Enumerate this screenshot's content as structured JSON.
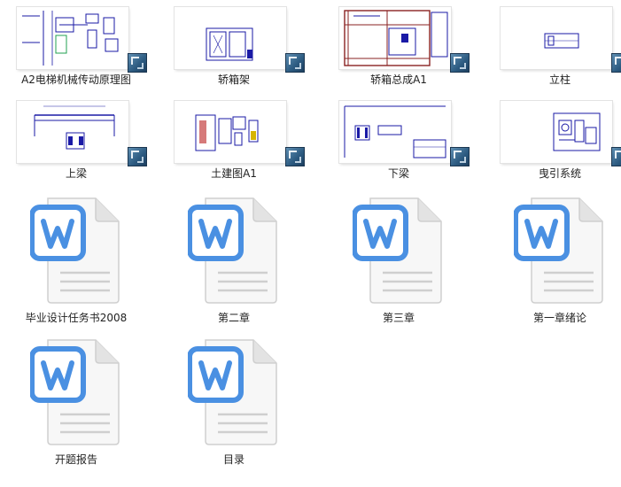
{
  "items": [
    {
      "name": "A2电梯机械传动原理图",
      "type": "cad"
    },
    {
      "name": "轿箱架",
      "type": "cad"
    },
    {
      "name": "轿箱总成A1",
      "type": "cad"
    },
    {
      "name": "立柱",
      "type": "cad"
    },
    {
      "name": "上梁",
      "type": "cad"
    },
    {
      "name": "土建图A1",
      "type": "cad"
    },
    {
      "name": "下梁",
      "type": "cad"
    },
    {
      "name": "曳引系统",
      "type": "cad"
    },
    {
      "name": "毕业设计任务书2008",
      "type": "word"
    },
    {
      "name": "第二章",
      "type": "word"
    },
    {
      "name": "第三章",
      "type": "word"
    },
    {
      "name": "第一章绪论",
      "type": "word"
    },
    {
      "name": "开题报告",
      "type": "word"
    },
    {
      "name": "目录",
      "type": "word"
    }
  ],
  "icons": {
    "cad": "cad-drawing-file-icon",
    "word": "word-document-icon"
  },
  "colors": {
    "drawing_blue": "#1a1aa6",
    "word_blue": "#4a90e2"
  }
}
